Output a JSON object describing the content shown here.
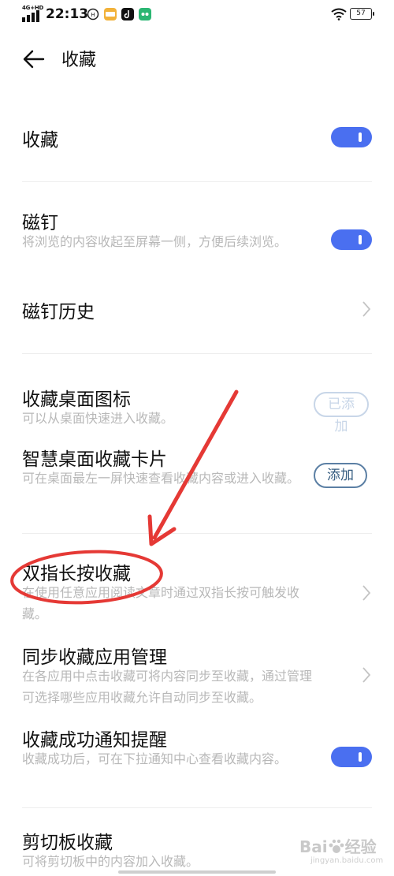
{
  "status_bar": {
    "network": "4G+HD",
    "time": "22:13",
    "battery": "57"
  },
  "header": {
    "title": "收藏"
  },
  "settings": [
    {
      "title": "收藏",
      "control": "toggle",
      "on": true
    },
    {
      "title": "磁钉",
      "desc": "将浏览的内容收起至屏幕一侧，方便后续浏览。",
      "control": "toggle",
      "on": true
    },
    {
      "title": "磁钉历史",
      "control": "chevron"
    },
    {
      "title": "收藏桌面图标",
      "desc": "可以从桌面快速进入收藏。",
      "control": "pill",
      "pill_label": "已添加",
      "pill_state": "disabled"
    },
    {
      "title": "智慧桌面收藏卡片",
      "desc": "可在桌面最左一屏快速查看收藏内容或进入收藏。",
      "control": "pill",
      "pill_label": "添加",
      "pill_state": "active"
    },
    {
      "title": "双指长按收藏",
      "desc": "在使用任意应用阅读文章时通过双指长按可触发收藏。",
      "control": "chevron"
    },
    {
      "title": "同步收藏应用管理",
      "desc": "在各应用中点击收藏可将内容同步至收藏，通过管理可选择哪些应用收藏允许自动同步至收藏。",
      "control": "chevron"
    },
    {
      "title": "收藏成功通知提醒",
      "desc": "收藏成功后，可在下拉通知中心查看收藏内容。",
      "control": "toggle",
      "on": true
    },
    {
      "title": "剪切板收藏",
      "desc": "可将剪切板中的内容加入收藏。"
    }
  ],
  "colors": {
    "accent": "#4a6ff0",
    "annotation": "#e53935",
    "desc_text": "#b8b8b8"
  },
  "watermark": {
    "text": "Bai",
    "glyph": "经验",
    "sub": "jingyan.baidu.com"
  }
}
